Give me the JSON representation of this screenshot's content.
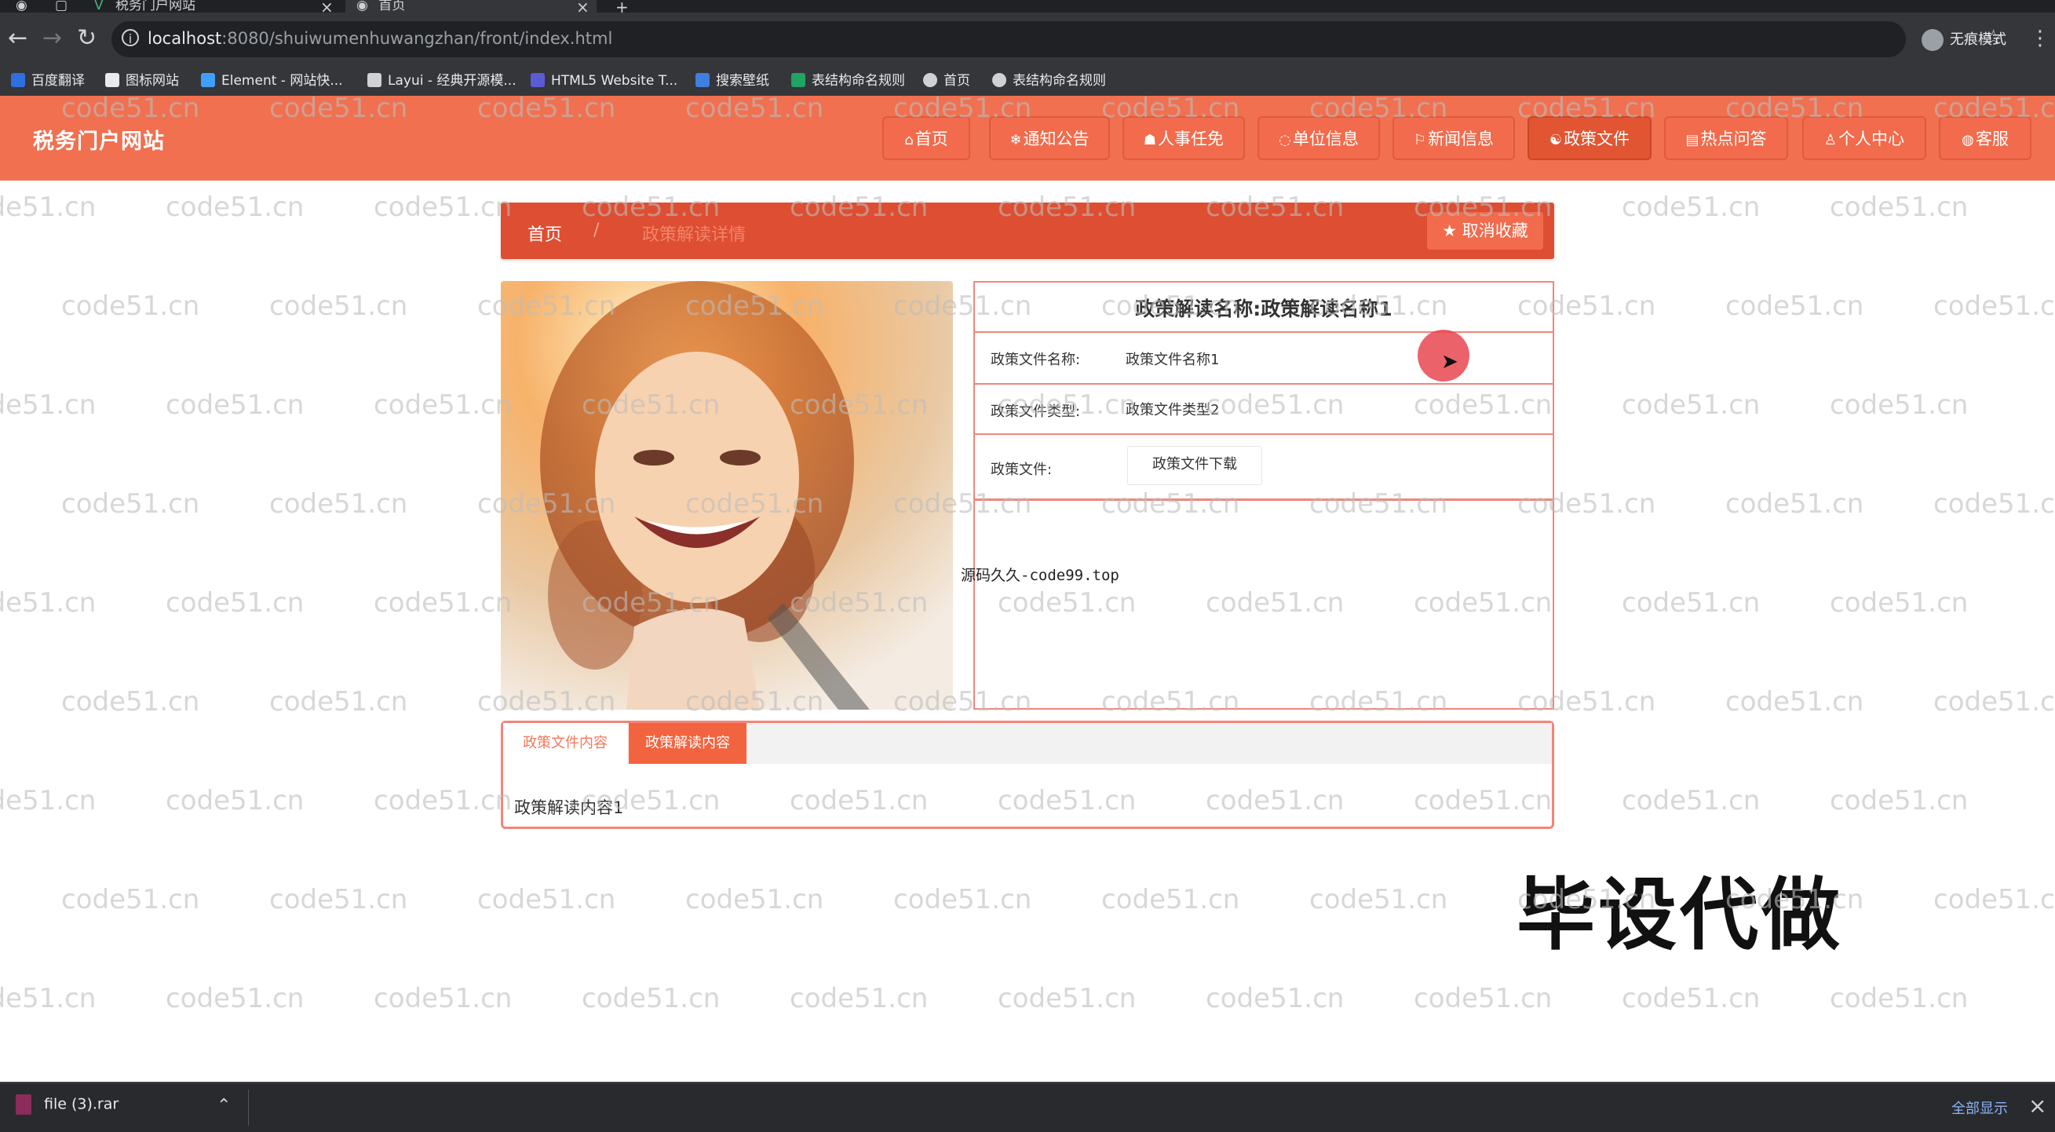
{
  "browser": {
    "tabs": [
      {
        "label": "税务门户网站"
      },
      {
        "label": "首页"
      }
    ],
    "url_host": "localhost",
    "url_rest": ":8080/shuiwumenhuwangzhan/front/index.html",
    "profile_label": "无痕模式",
    "bookmarks": [
      {
        "label": "百度翻译",
        "color": "#2f6fdf"
      },
      {
        "label": "图标网站",
        "color": "#e8eaed"
      },
      {
        "label": "Element - 网站快...",
        "color": "#409eff"
      },
      {
        "label": "Layui - 经典开源模...",
        "color": "#cfd1d4"
      },
      {
        "label": "HTML5 Website T...",
        "color": "#5b5bd6"
      },
      {
        "label": "搜索壁纸",
        "color": "#3f7fe0"
      },
      {
        "label": "表结构命名规则",
        "color": "#1fa463"
      },
      {
        "label": "首页",
        "color": "#cfd1d4"
      },
      {
        "label": "表结构命名规则",
        "color": "#cfd1d4"
      }
    ]
  },
  "site": {
    "title": "税务门户网站",
    "nav": [
      {
        "label": "首页",
        "icon": "home-icon",
        "glyph": "⌂"
      },
      {
        "label": "通知公告",
        "icon": "snowflake-icon",
        "glyph": "❄"
      },
      {
        "label": "人事任免",
        "icon": "graduation-cap-icon",
        "glyph": "☗"
      },
      {
        "label": "单位信息",
        "icon": "chat-bubble-icon",
        "glyph": "◌"
      },
      {
        "label": "新闻信息",
        "icon": "flag-icon",
        "glyph": "⚐"
      },
      {
        "label": "政策文件",
        "icon": "palette-icon",
        "glyph": "☯"
      },
      {
        "label": "热点问答",
        "icon": "calendar-icon",
        "glyph": "▤"
      },
      {
        "label": "个人中心",
        "icon": "user-icon",
        "glyph": "♙"
      },
      {
        "label": "客服",
        "icon": "support-icon",
        "glyph": "◍"
      }
    ],
    "accent": "#f07050"
  },
  "breadcrumb": {
    "home": "首页",
    "separator": "/",
    "current": "政策解读详情"
  },
  "favorite_button": "取消收藏",
  "detail": {
    "title": "政策解读名称:政策解读名称1",
    "rows": [
      {
        "label": "政策文件名称:",
        "value": "政策文件名称1"
      },
      {
        "label": "政策文件类型:",
        "value": "政策文件类型2"
      }
    ],
    "file_label": "政策文件:",
    "download_button": "政策文件下载"
  },
  "overlay_note": "源码久久-code99.top",
  "tabs": {
    "items": [
      "政策文件内容",
      "政策解读内容"
    ],
    "active": 1,
    "content": "政策解读内容1"
  },
  "overlay_big_text": "毕设代做",
  "watermark_text": "code51.cn",
  "download_bar": {
    "file": "file (3).rar",
    "show_all": "全部显示"
  }
}
